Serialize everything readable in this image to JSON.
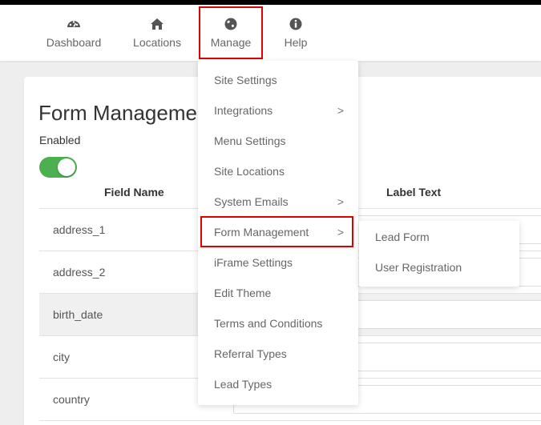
{
  "nav": {
    "items": [
      {
        "label": "Dashboard",
        "icon": "dashboard-gauge-icon"
      },
      {
        "label": "Locations",
        "icon": "home-icon"
      },
      {
        "label": "Manage",
        "icon": "globe-icon"
      },
      {
        "label": "Help",
        "icon": "info-icon"
      }
    ]
  },
  "page": {
    "title": "Form Management",
    "enabled_label": "Enabled",
    "enabled": true
  },
  "table": {
    "headers": {
      "field_name": "Field Name",
      "label_text": "Label Text"
    },
    "rows": [
      "address_1",
      "address_2",
      "birth_date",
      "city",
      "country"
    ]
  },
  "manage_menu": {
    "items": [
      {
        "label": "Site Settings"
      },
      {
        "label": "Integrations",
        "chevron": ">"
      },
      {
        "label": "Menu Settings"
      },
      {
        "label": "Site Locations"
      },
      {
        "label": "System Emails",
        "chevron": ">"
      },
      {
        "label": "Form Management",
        "chevron": ">"
      },
      {
        "label": "iFrame Settings"
      },
      {
        "label": "Edit Theme"
      },
      {
        "label": "Terms and Conditions"
      },
      {
        "label": "Referral Types"
      },
      {
        "label": "Lead Types"
      }
    ]
  },
  "form_submenu": {
    "items": [
      {
        "label": "Lead Form"
      },
      {
        "label": "User Registration"
      }
    ]
  },
  "colors": {
    "highlight": "#e00000",
    "toggle_on": "#4caf50"
  }
}
